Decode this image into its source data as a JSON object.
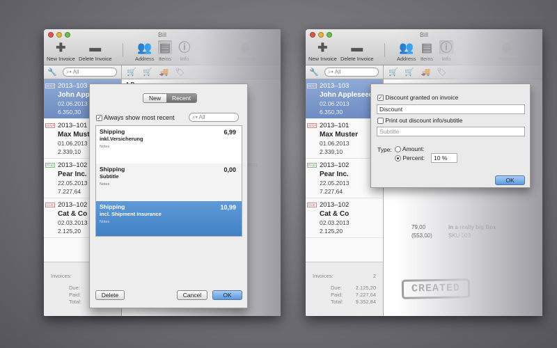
{
  "window": {
    "title": "Bill"
  },
  "toolbar": {
    "new_invoice": "New Invoice",
    "delete_invoice": "Delete Invoice",
    "address": "Address",
    "items": "Items",
    "info": "Info",
    "preview": "Preview"
  },
  "sidebar": {
    "search_placeholder": "All",
    "invoices": [
      {
        "number": "2013–103",
        "name": "John Appleseed",
        "date": "02.06.2013",
        "amount": "6.350,30",
        "status": "sent"
      },
      {
        "number": "2013–101",
        "name": "Max Muster",
        "date": "01.06.2013",
        "amount": "2.339,10",
        "status": "sent"
      },
      {
        "number": "2013–102",
        "name": "Pear Inc.",
        "date": "22.05.2013",
        "amount": "7.227,64",
        "status": "paid"
      },
      {
        "number": "2013–102",
        "name": "Cat & Co",
        "date": "02.03.2013",
        "amount": "2.125,20",
        "status": "due"
      }
    ],
    "left_invoice_names": [
      "John Apples",
      "Max Muster",
      "Pear Inc.",
      "Cat & Co"
    ],
    "footer": {
      "invoices_label": "Invoices:",
      "invoices_value": "2",
      "due_label": "Due:",
      "due_value": "2.125,20",
      "paid_label": "Paid:",
      "paid_value": "7.227,64",
      "total_label": "Total:",
      "total_value": "9.352,84"
    }
  },
  "items_sheet": {
    "segments": [
      "New",
      "Recent"
    ],
    "always_show_label": "Always show most recent",
    "search_placeholder": "All",
    "items": [
      {
        "title": "Shipping",
        "subtitle": "inkl.Versicherung",
        "notes": "Notes",
        "price": "6,99"
      },
      {
        "title": "Shipping",
        "subtitle": "Subtitle",
        "notes": "Notes",
        "price": "0,00"
      },
      {
        "title": "Shipping",
        "subtitle": "incl. Shipment Insurance",
        "notes": "Notes",
        "price": "10,99"
      }
    ],
    "delete_label": "Delete",
    "cancel_label": "Cancel",
    "ok_label": "OK"
  },
  "detail_peek": {
    "left_header": "1 P",
    "left_fragment": "hing",
    "right_line1_price": "79,00",
    "right_line1_text": "in a really big Box",
    "right_line2_price": "(553,00)",
    "right_line2_sku": "SKU 003",
    "stamp": "CREATED"
  },
  "discount_popover": {
    "discount_check_label": "Discount granted on invoice",
    "discount_value": "Discount",
    "print_label": "Print out discount info/subtitle",
    "subtitle_placeholder": "Subtitle",
    "type_label": "Type:",
    "amount_label": "Amount:",
    "percent_label": "Percent:",
    "percent_value": "10 %",
    "ok_label": "OK"
  }
}
